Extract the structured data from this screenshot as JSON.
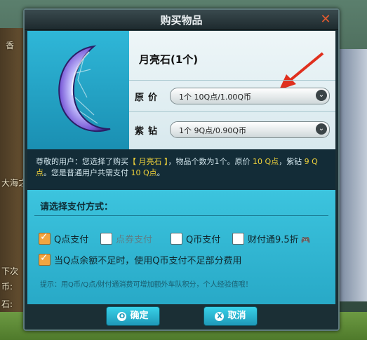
{
  "background": {
    "texts": [
      "大海之",
      "下次",
      "币:",
      "石:",
      "香"
    ]
  },
  "dialog": {
    "title": "购买物品",
    "close_icon": "close-icon"
  },
  "item": {
    "name": "月亮石(1个)",
    "icon": "crescent-moon-gem-icon",
    "original_price_label": "原价",
    "original_price_value": "1个   10Q点/1.00Q币",
    "purple_price_label": "紫钻",
    "purple_price_value": "1个   9Q点/0.90Q币"
  },
  "notice": {
    "text_part1": "尊敬的用户：您选择了购买",
    "item_highlight": "【 月亮石 】",
    "text_part2": "，物品个数为1个。原价 ",
    "price_highlight": "10 Q点",
    "text_part3": "，紫钻 ",
    "purple_highlight": "9 Q点",
    "text_part4": "。您是普通用户共需支付 ",
    "total_highlight": "10 Q点",
    "text_part5": "。"
  },
  "payment": {
    "title": "请选择支付方式：",
    "options": [
      {
        "label": "Q点支付",
        "checked": true
      },
      {
        "label": "点券支付",
        "checked": false
      },
      {
        "label": "Q币支付",
        "checked": false
      },
      {
        "label": "财付通9.5折",
        "checked": false
      }
    ],
    "fallback_label": "当Q点余额不足时，使用Q币支付不足部分费用",
    "fallback_checked": true,
    "hint": "提示：用Q币/Q点/财付通消费可增加额外车队积分，个人经验值哦！"
  },
  "buttons": {
    "confirm": "确定",
    "cancel": "取消"
  },
  "colors": {
    "accent_blue": "#2fb7d8",
    "highlight_yellow": "#f0d23a",
    "arrow_red": "#e0301e"
  }
}
